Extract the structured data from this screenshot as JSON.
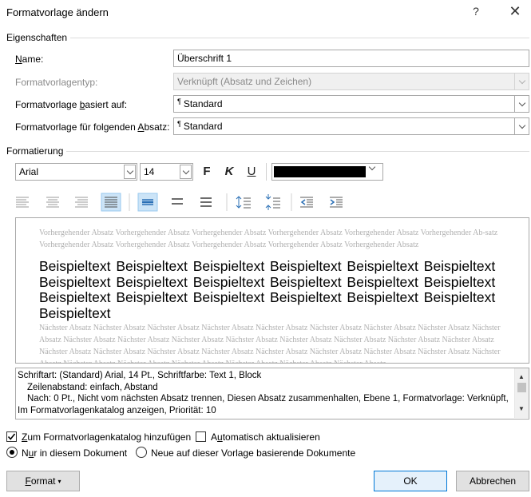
{
  "window": {
    "title": "Formatvorlage ändern",
    "help_glyph": "?",
    "close_glyph": "✕"
  },
  "properties": {
    "group_label": "Eigenschaften",
    "name_label": "Name:",
    "name_value": "Überschrift 1",
    "type_label": "Formatvorlagentyp:",
    "type_value": "Verknüpft (Absatz und Zeichen)",
    "based_label": "Formatvorlage basiert auf:",
    "based_value": "Standard",
    "next_label": "Formatvorlage für folgenden Absatz:",
    "next_value": "Standard",
    "para_mark": "¶"
  },
  "formatting": {
    "group_label": "Formatierung",
    "font": "Arial",
    "size": "14",
    "bold": "F",
    "italic": "K",
    "underline": "U",
    "font_color": "#000000"
  },
  "preview": {
    "previous_text": "Vorhergehender Absatz Vorhergehender Absatz Vorhergehender Absatz Vorhergehender Absatz Vorhergehender Absatz Vorhergehender Ab-satz Vorhergehender Absatz Vorhergehender Absatz Vorhergehender Absatz Vorhergehender Absatz Vorhergehender Absatz",
    "sample_text": "Beispieltext Beispieltext Beispieltext Beispieltext Beispieltext Beispieltext Beispieltext Beispieltext Beispieltext Beispieltext Beispieltext Beispieltext Beispieltext Beispieltext Beispieltext Beispieltext Beispieltext Beispieltext Beispieltext",
    "next_text": "Nächster Absatz Nächster Absatz Nächster Absatz Nächster Absatz Nächster Absatz Nächster Absatz Nächster Absatz Nächster Absatz Nächster Absatz Nächster Absatz Nächster Absatz Nächster Absatz Nächster Absatz Nächster Absatz Nächster Absatz Nächster Absatz Nächster Absatz Nächster Absatz Nächster Absatz Nächster Absatz Nächster Absatz Nächster Absatz Nächster Absatz Nächster Absatz Nächster Absatz Nächster Absatz Nächster Absatz Nächster Absatz Nächster Absatz Nächster Absatz Nächster Absatz Nächster Absatz"
  },
  "description": {
    "line1": "Schriftart: (Standard) Arial, 14 Pt., Schriftfarbe: Text 1, Block",
    "line2": "Zeilenabstand:  einfach, Abstand",
    "line3": "Nach:  0 Pt., Nicht vom nächsten Absatz trennen, Diesen Absatz zusammenhalten, Ebene 1, Formatvorlage: Verknüpft,",
    "line4": "Im Formatvorlagenkatalog anzeigen, Priorität: 10"
  },
  "options": {
    "add_to_gallery": "Zum Formatvorlagenkatalog hinzufügen",
    "add_to_gallery_checked": true,
    "auto_update": "Automatisch aktualisieren",
    "auto_update_checked": false,
    "only_this_doc": "Nur in diesem Dokument",
    "new_docs": "Neue auf dieser Vorlage basierende Dokumente"
  },
  "buttons": {
    "format": "Format",
    "ok": "OK",
    "cancel": "Abbrechen"
  }
}
